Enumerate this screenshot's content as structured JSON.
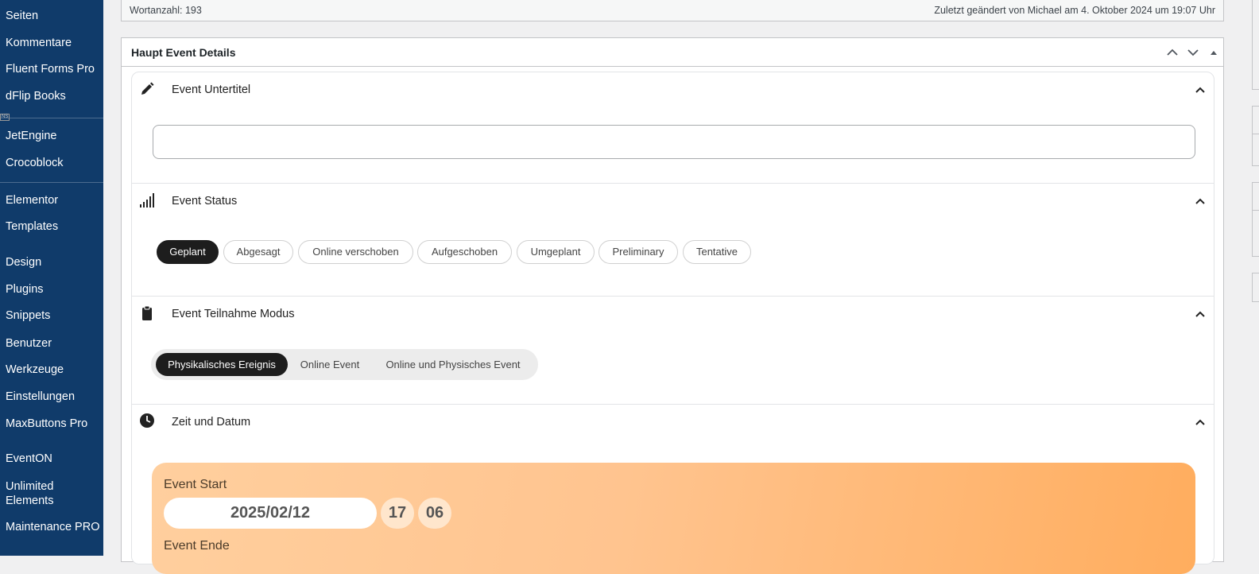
{
  "sidebar": {
    "items": [
      {
        "label": "Seiten"
      },
      {
        "label": "Kommentare"
      },
      {
        "label": "Fluent Forms Pro"
      },
      {
        "label": "dFlip Books"
      },
      {
        "label": "JetEngine"
      },
      {
        "label": "Crocoblock"
      },
      {
        "label": "Elementor"
      },
      {
        "label": "Templates"
      },
      {
        "label": "Design"
      },
      {
        "label": "Plugins"
      },
      {
        "label": "Snippets"
      },
      {
        "label": "Benutzer"
      },
      {
        "label": "Werkzeuge"
      },
      {
        "label": "Einstellungen"
      },
      {
        "label": "MaxButtons Pro"
      },
      {
        "label": "EventON"
      },
      {
        "label": "Unlimited Elements"
      },
      {
        "label": "Maintenance PRO"
      }
    ],
    "ns_badge": "NS"
  },
  "status_bar": {
    "word_count": "Wortanzahl: 193",
    "last_edit": "Zuletzt geändert von Michael am 4. Oktober 2024 um 19:07 Uhr"
  },
  "metabox": {
    "title": "Haupt Event Details",
    "sections": {
      "subtitle": {
        "title": "Event Untertitel",
        "input_value": ""
      },
      "status": {
        "title": "Event Status",
        "options": [
          "Geplant",
          "Abgesagt",
          "Online verschoben",
          "Aufgeschoben",
          "Umgeplant",
          "Preliminary",
          "Tentative"
        ],
        "selected": "Geplant"
      },
      "attendance": {
        "title": "Event Teilnahme Modus",
        "options": [
          "Physikalisches Ereignis",
          "Online Event",
          "Online und Physisches Event"
        ],
        "selected": "Physikalisches Ereignis"
      },
      "datetime": {
        "title": "Zeit und Datum",
        "start_label": "Event Start",
        "start_date": "2025/02/12",
        "start_hour": "17",
        "start_minute": "06",
        "end_label": "Event Ende"
      }
    }
  },
  "colors": {
    "sidebar_bg": "#103b6a",
    "active_pill": "#1d1d1d",
    "time_card_gradient_start": "#ffcf9e",
    "time_card_gradient_end": "#ffad5e"
  }
}
